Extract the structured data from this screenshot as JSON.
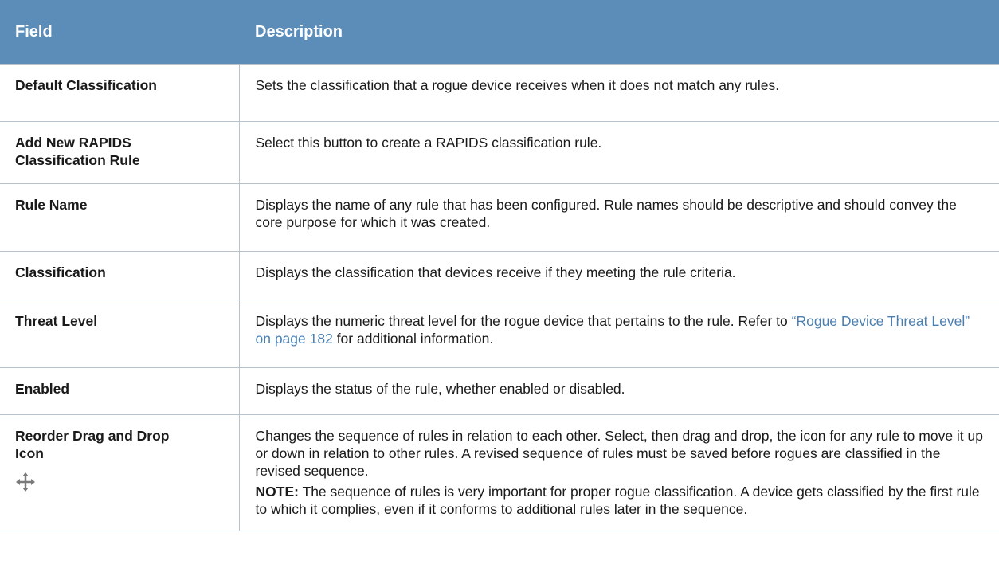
{
  "table": {
    "header": {
      "field": "Field",
      "description": "Description"
    },
    "rows": [
      {
        "field": "Default Classification",
        "description": "Sets the classification that a rogue device receives when it does not match any rules."
      },
      {
        "field_line1": "Add New RAPIDS",
        "field_line2": "Classification Rule",
        "description": "Select this button to create a RAPIDS classification rule."
      },
      {
        "field": "Rule Name",
        "description": "Displays the name of any rule that has been configured. Rule names should be descriptive and should convey the core purpose for which it was created."
      },
      {
        "field": "Classification",
        "description": "Displays the classification that devices receive if they meeting the rule criteria."
      },
      {
        "field": "Threat Level",
        "description_pre": "Displays the numeric threat level for the rogue device that pertains to the rule. Refer to ",
        "description_link": "“Rogue Device Threat Level” on page 182",
        "description_post": " for additional information."
      },
      {
        "field": "Enabled",
        "description": "Displays the status of the rule, whether enabled or disabled."
      },
      {
        "field_line1": "Reorder Drag and Drop",
        "field_line2": "Icon",
        "icon": "move-arrows-icon",
        "description": "Changes the sequence of rules in relation to each other. Select, then drag and drop, the icon for any rule to move it up or down in relation to other rules. A revised sequence of rules must be saved before rogues are classified in the revised sequence.",
        "note_label": "NOTE:",
        "note_text": " The sequence of rules is very important for proper rogue classification. A device gets classified by the first rule to which it complies, even if it conforms to additional rules later in the sequence."
      }
    ]
  },
  "colors": {
    "header_bg": "#5b8db8",
    "link": "#4a7fb0",
    "border": "#b8c2cc"
  }
}
